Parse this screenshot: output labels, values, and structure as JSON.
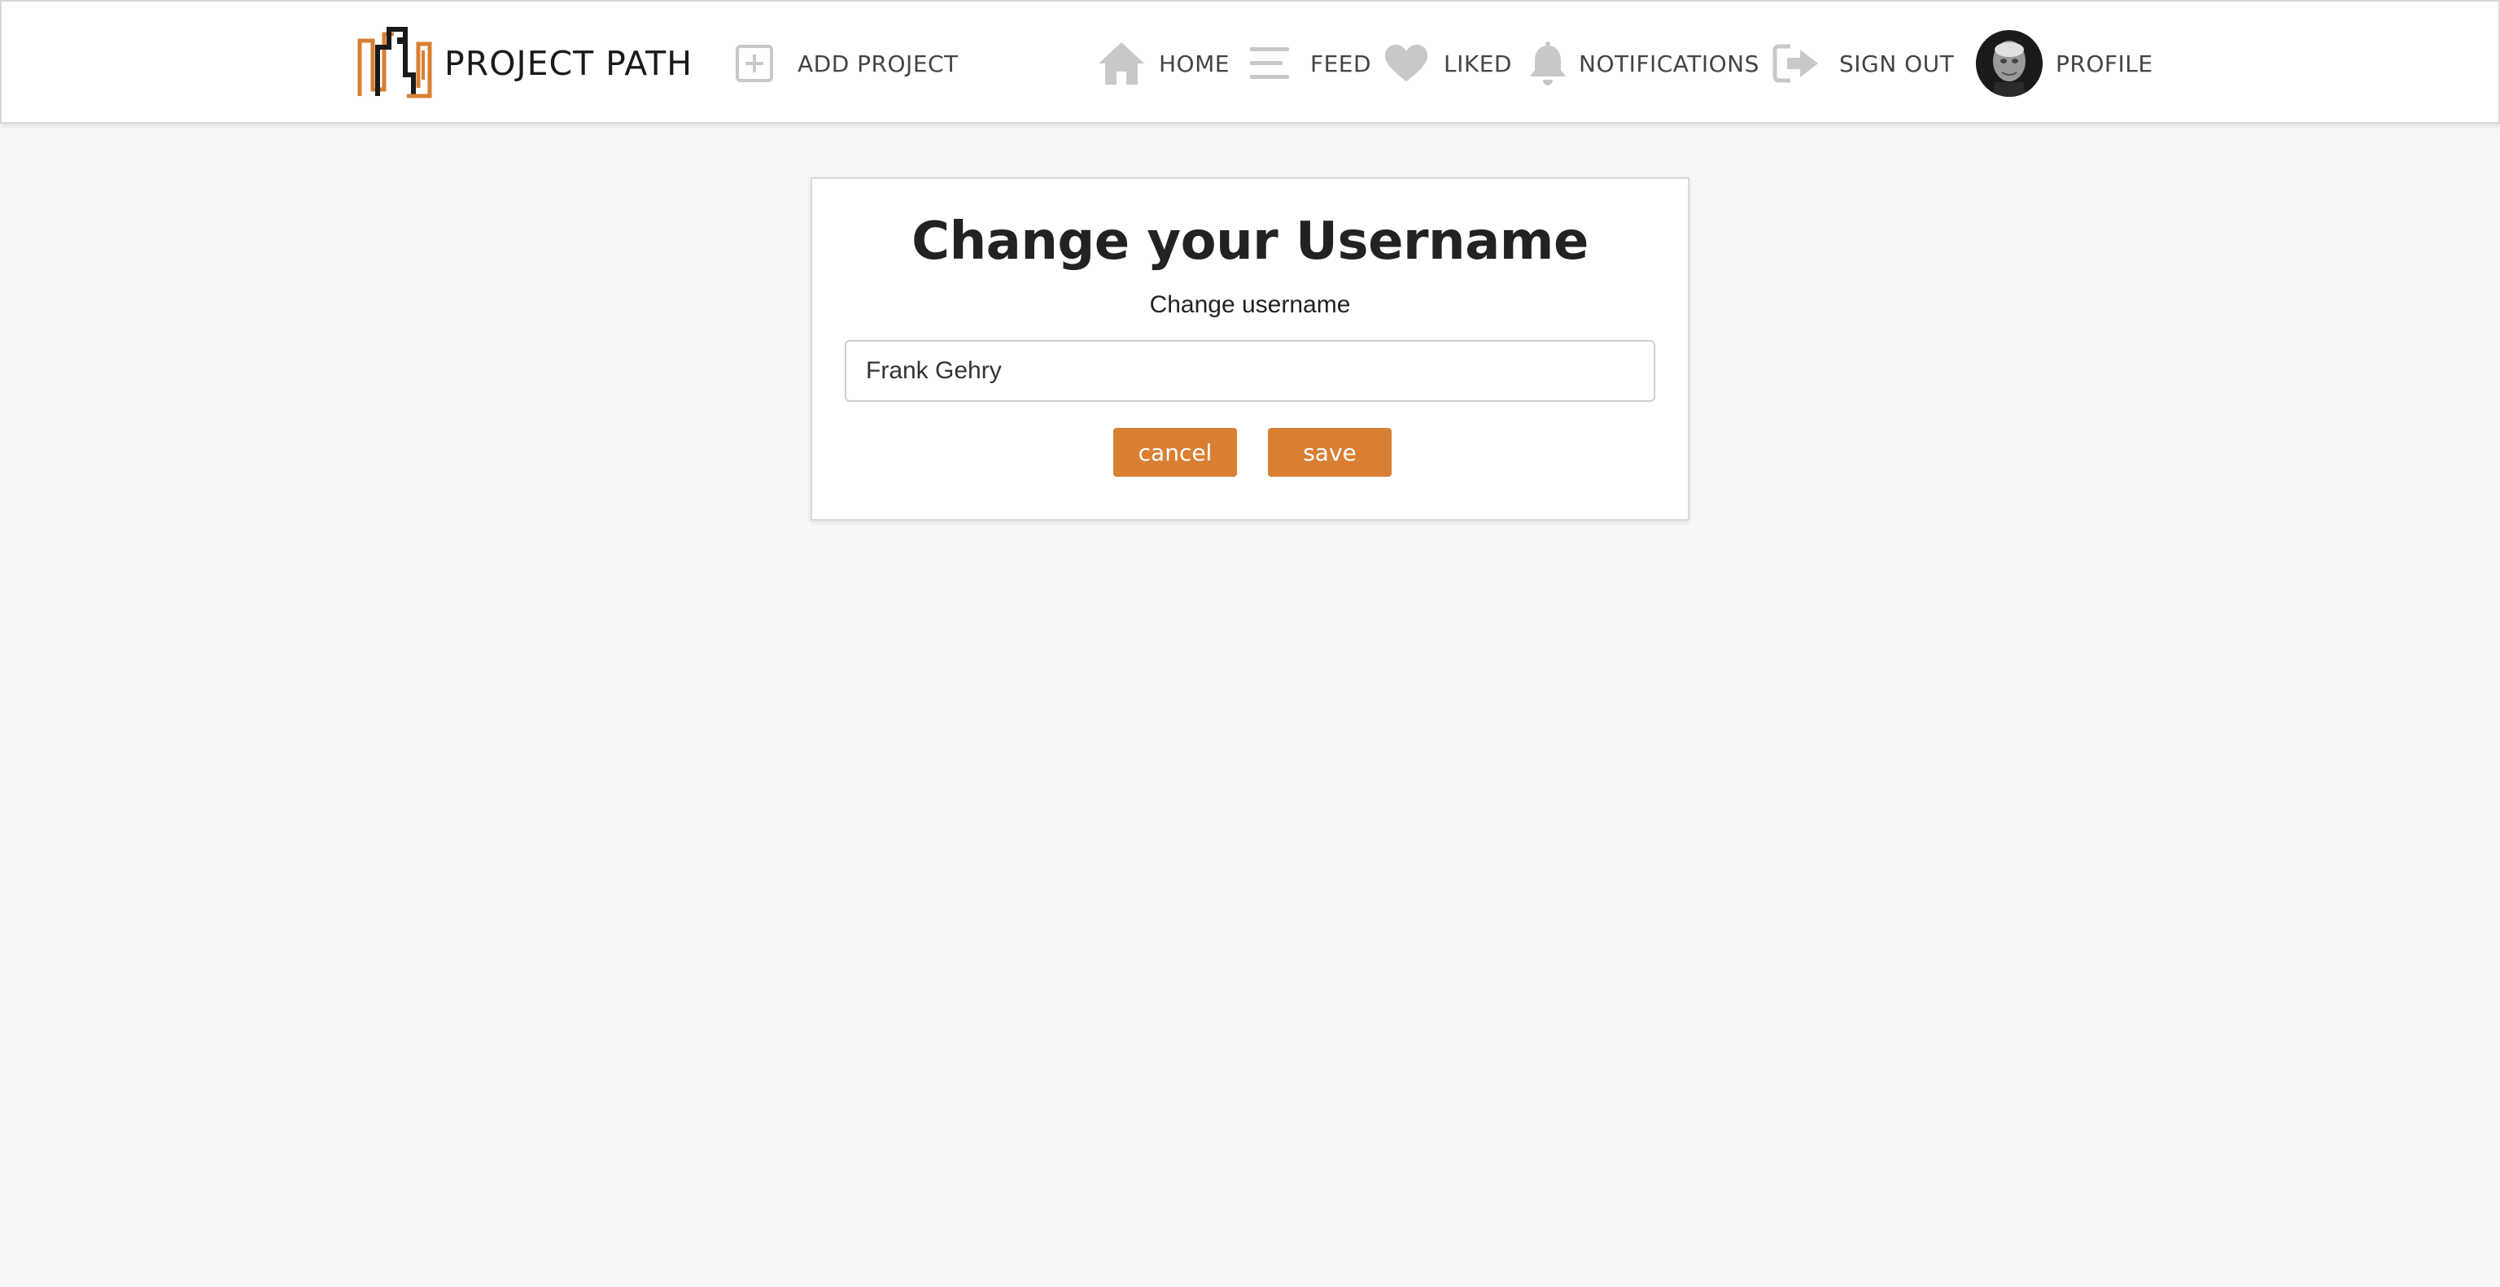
{
  "nav": {
    "brand": {
      "name": "PROJECT PATH",
      "logo_icon": "project-path-logo"
    },
    "add_project": {
      "label": "ADD PROJECT",
      "icon": "plus-square-icon"
    },
    "home": {
      "label": "HOME",
      "icon": "home-icon"
    },
    "feed": {
      "label": "FEED",
      "icon": "menu-lines-icon"
    },
    "liked": {
      "label": "LIKED",
      "icon": "heart-icon"
    },
    "notifications": {
      "label": "NOTIFICATIONS",
      "icon": "bell-icon"
    },
    "sign_out": {
      "label": "SIGN OUT",
      "icon": "sign-out-icon"
    },
    "profile": {
      "label": "PROFILE",
      "avatar": "user-avatar"
    }
  },
  "form": {
    "title": "Change your Username",
    "field_label": "Change username",
    "username_value": "Frank Gehry",
    "cancel_label": "cancel",
    "save_label": "save"
  },
  "colors": {
    "accent": "#d97f32",
    "nav_icon": "#c8c8c8",
    "background": "#f7f7f7",
    "card": "#ffffff"
  }
}
